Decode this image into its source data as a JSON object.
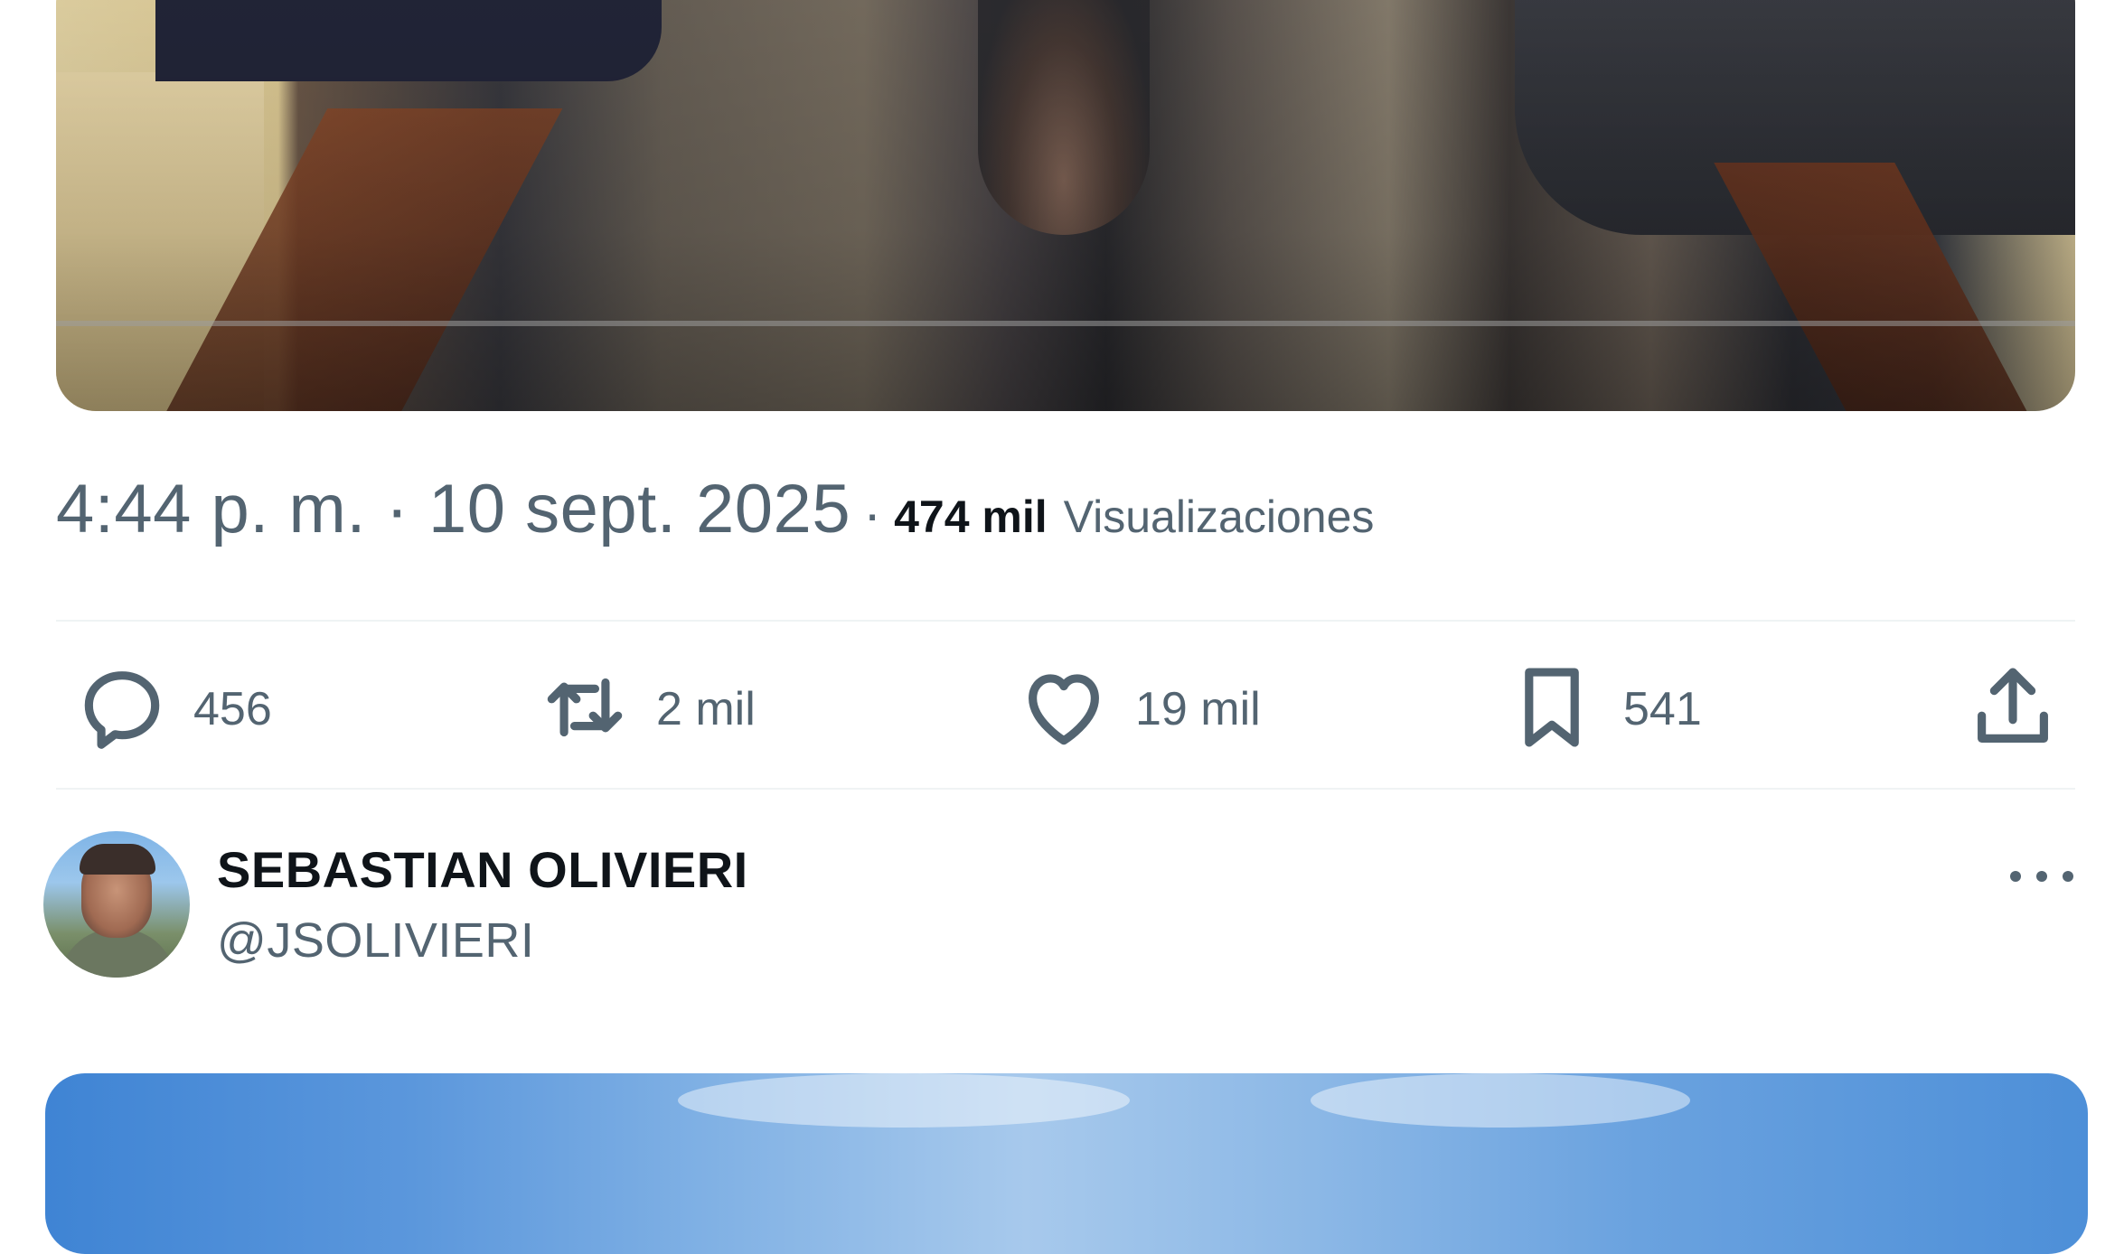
{
  "tweet": {
    "timestamp": "4:44 p. m. · 10 sept. 2025",
    "separator": "·",
    "views_count": "474 mil",
    "views_label": "Visualizaciones"
  },
  "actions": {
    "reply": {
      "icon": "reply-icon",
      "count": "456"
    },
    "retweet": {
      "icon": "retweet-icon",
      "count": "2 mil"
    },
    "like": {
      "icon": "heart-icon",
      "count": "19 mil"
    },
    "bookmark": {
      "icon": "bookmark-icon",
      "count": "541"
    },
    "share": {
      "icon": "share-icon"
    }
  },
  "next_post": {
    "author_name": "SEBASTIAN OLIVIERI",
    "author_handle": "@JSOLIVIERI"
  },
  "colors": {
    "text_primary": "#0f1419",
    "text_secondary": "#536471",
    "divider": "#eff3f4",
    "background": "#ffffff"
  }
}
